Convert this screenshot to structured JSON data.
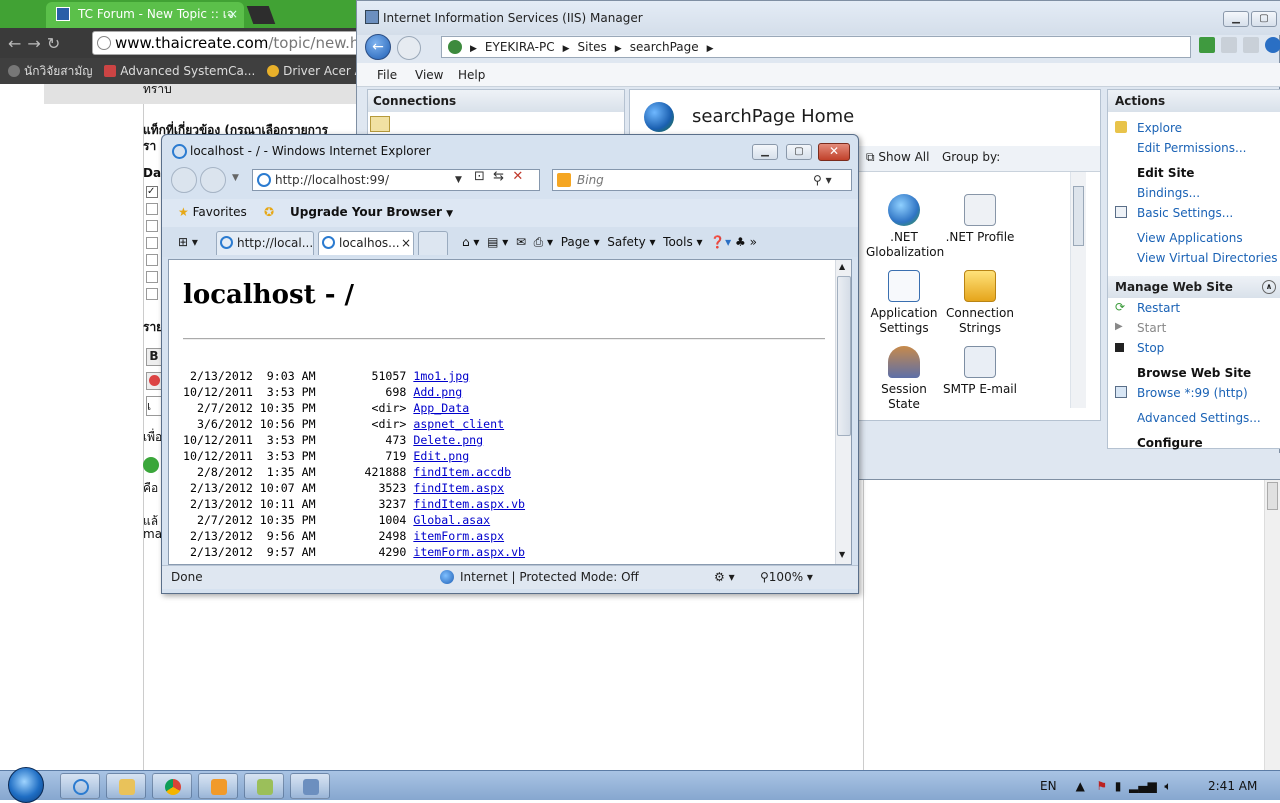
{
  "chrome": {
    "tab_title": "TC Forum - New Topic :: เจ",
    "tab_close": "×",
    "url_domain": "www.thaicreate.com",
    "url_path": "/topic/new.htm",
    "bookmarks": [
      "นักวิจัยสามัญ",
      "Advanced SystemCa...",
      "Driver Acer Asp"
    ],
    "page_text": {
      "line1": "ทราบ",
      "tags_heading": "แท็กที่เกี่ยวข้อง (กรุณาเลือกรายการ",
      "tags_sub": "รา",
      "dat": "Dat",
      "rai": "ราย",
      "bold_btn": "B",
      "input_text": "เ",
      "phuea": "เพื่อ",
      "kho": "คือ",
      "lae": "แล้",
      "ma": "ma"
    }
  },
  "iis": {
    "title": "Internet Information Services (IIS) Manager",
    "breadcrumb": [
      "EYEKIRA-PC",
      "Sites",
      "searchPage"
    ],
    "menu": [
      "File",
      "View",
      "Help"
    ],
    "connections_header": "Connections",
    "center_title": "searchPage Home",
    "show_all": "Show All",
    "group_by": "Group by:",
    "features": [
      {
        "label": ".NET Globalization",
        "icon": "globe-icon"
      },
      {
        "label": ".NET Profile",
        "icon": "profile-icon"
      },
      {
        "label": "Application Settings",
        "icon": "settings-list-icon"
      },
      {
        "label": "Connection Strings",
        "icon": "database-icon"
      },
      {
        "label": "Session State",
        "icon": "session-user-icon"
      },
      {
        "label": "SMTP E-mail",
        "icon": "email-icon"
      }
    ],
    "actions_header": "Actions",
    "actions": {
      "explore": "Explore",
      "edit_permissions": "Edit Permissions...",
      "edit_site": "Edit Site",
      "bindings": "Bindings...",
      "basic_settings": "Basic Settings...",
      "view_applications": "View Applications",
      "view_virtual_directories": "View Virtual Directories",
      "manage_web_site": "Manage Web Site",
      "restart": "Restart",
      "start": "Start",
      "stop": "Stop",
      "browse_web_site": "Browse Web Site",
      "browse_99": "Browse *:99 (http)",
      "advanced_settings": "Advanced Settings...",
      "configure": "Configure"
    }
  },
  "ie": {
    "title": "localhost - / - Windows Internet Explorer",
    "url": "http://localhost:99/",
    "search_placeholder": "Bing",
    "favorites": "Favorites",
    "upgrade": "Upgrade Your Browser",
    "tabs": [
      "http://local...",
      "localhos..."
    ],
    "tab_close": "×",
    "toolbar": {
      "page": "Page",
      "safety": "Safety",
      "tools": "Tools"
    },
    "heading": "localhost - /",
    "listing": [
      {
        "date": "2/13/2012",
        "time": "9:03 AM",
        "size": "51057",
        "name": "1mo1.jpg"
      },
      {
        "date": "10/12/2011",
        "time": "3:53 PM",
        "size": "698",
        "name": "Add.png"
      },
      {
        "date": "2/7/2012",
        "time": "10:35 PM",
        "size": "<dir>",
        "name": "App_Data"
      },
      {
        "date": "3/6/2012",
        "time": "10:56 PM",
        "size": "<dir>",
        "name": "aspnet_client"
      },
      {
        "date": "10/12/2011",
        "time": "3:53 PM",
        "size": "473",
        "name": "Delete.png"
      },
      {
        "date": "10/12/2011",
        "time": "3:53 PM",
        "size": "719",
        "name": "Edit.png"
      },
      {
        "date": "2/8/2012",
        "time": "1:35 AM",
        "size": "421888",
        "name": "findItem.accdb"
      },
      {
        "date": "2/13/2012",
        "time": "10:07 AM",
        "size": "3523",
        "name": "findItem.aspx"
      },
      {
        "date": "2/13/2012",
        "time": "10:11 AM",
        "size": "3237",
        "name": "findItem.aspx.vb"
      },
      {
        "date": "2/7/2012",
        "time": "10:35 PM",
        "size": "1004",
        "name": "Global.asax"
      },
      {
        "date": "2/13/2012",
        "time": "9:56 AM",
        "size": "2498",
        "name": "itemForm.aspx"
      },
      {
        "date": "2/13/2012",
        "time": "9:57 AM",
        "size": "4290",
        "name": "itemForm.aspx.vb"
      }
    ],
    "status_done": "Done",
    "status_zone": "Internet | Protected Mode: Off",
    "zoom": "100%"
  },
  "taskbar": {
    "lang": "EN",
    "clock": "2:41 AM"
  }
}
